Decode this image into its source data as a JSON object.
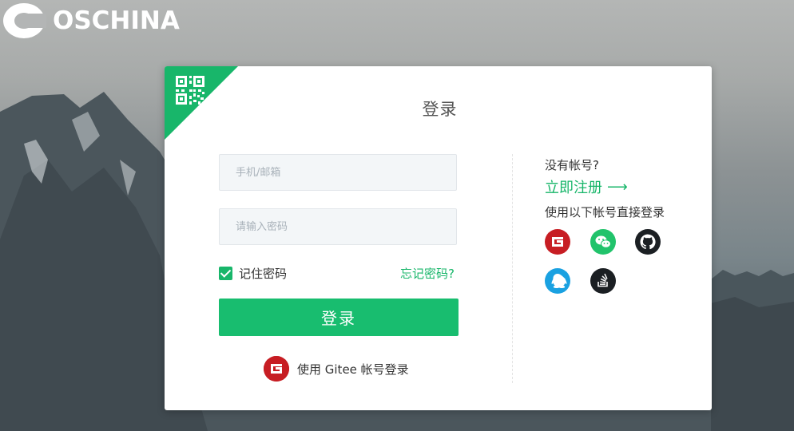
{
  "brand": {
    "name": "OSCHINA"
  },
  "login": {
    "title": "登录",
    "phone_placeholder": "手机/邮箱",
    "password_placeholder": "请输入密码",
    "remember_label": "记住密码",
    "remember_checked": true,
    "forgot_label": "忘记密码?",
    "submit_label": "登录",
    "gitee_login_label": "使用 Gitee 帐号登录"
  },
  "sidebar": {
    "no_account": "没有帐号?",
    "register_label": "立即注册",
    "register_arrow": "⟶",
    "other_accounts": "使用以下帐号直接登录",
    "providers": [
      "gitee",
      "wechat",
      "github",
      "qq",
      "stackoverflow"
    ]
  },
  "colors": {
    "accent": "#18b66a",
    "gitee": "#c71d23",
    "wechat": "#21c36b",
    "qq": "#1aa1e1",
    "github": "#1b1f23"
  }
}
